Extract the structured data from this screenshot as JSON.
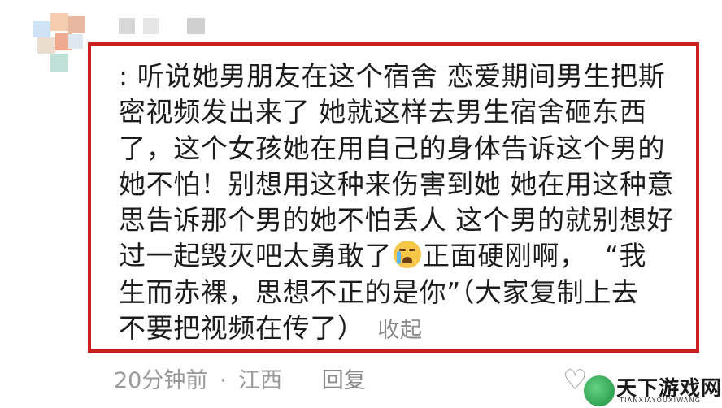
{
  "comment": {
    "lines": [
      ": 听说她男朋友在这个宿舍 恋爱期间男生把斯",
      "密视频发出来了 她就这样去男生宿舍砸东西",
      "了，这个女孩她在用自己的身体告诉这个男的",
      "她不怕！别想用这种来伤害到她 她在用这种意",
      "思告诉那个男的她不怕丢人 这个男的就别想好"
    ],
    "line6_before_emoji": "过一起毁灭吧太勇敢了",
    "line6_after_emoji": "正面硬刚啊，  “我",
    "line7": "生而赤裸，思想不正的是你”（大家复制上去",
    "line8": "不要把视频在传了）",
    "emoji": "crying-face",
    "collapse_label": "收起"
  },
  "meta": {
    "time": "20分钟前",
    "separator": "·",
    "location": "江西",
    "reply_label": "回复"
  },
  "like": {
    "icon": "heart-outline-icon",
    "glyph": "♡"
  },
  "watermark": {
    "title": "天下游戏网",
    "subtitle": "TIANXIAYOUXIWANG"
  },
  "colors": {
    "highlight_border": "#c8201f",
    "text": "#1c1c1c",
    "muted": "#9a9a9a"
  }
}
